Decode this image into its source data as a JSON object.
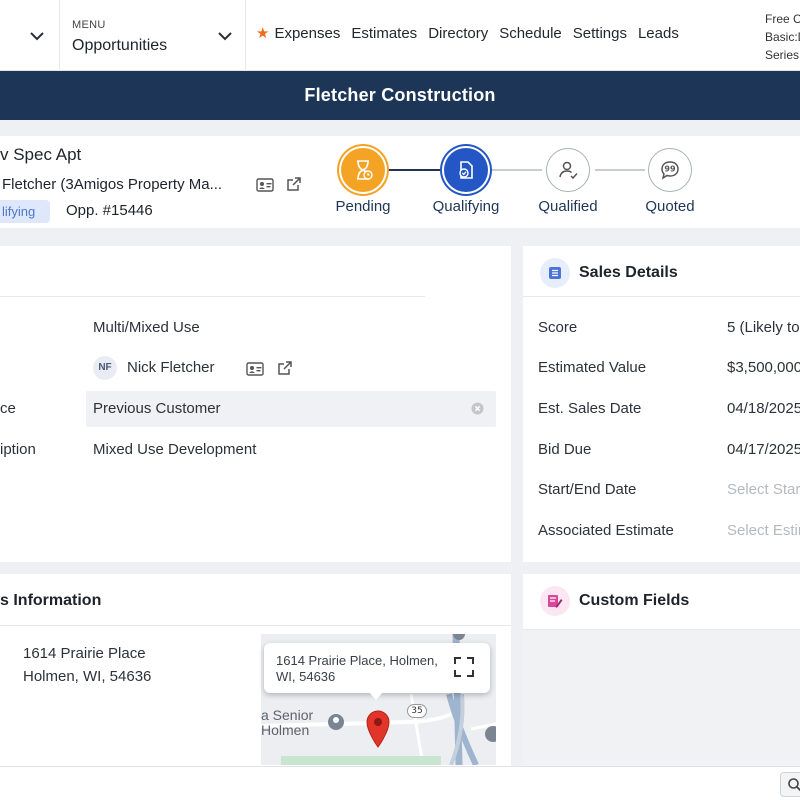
{
  "nav": {
    "menu_label": "MENU",
    "menu_value": "Opportunities",
    "links": [
      "Expenses",
      "Estimates",
      "Directory",
      "Schedule",
      "Settings",
      "Leads"
    ],
    "plan_lines": [
      "Free C",
      "Basic:D",
      "Series:"
    ],
    "accent_star": "#f26b1d"
  },
  "banner": {
    "company": "Fletcher Construction",
    "color": "#1d3557"
  },
  "header": {
    "title": "v Spec Apt",
    "contact": "Fletcher (3Amigos Property Ma...",
    "status_badge": "lifying",
    "opp_number": "Opp. #15446",
    "stages": [
      {
        "label": "Pending",
        "state": "done",
        "icon": "hourglass-icon"
      },
      {
        "label": "Qualifying",
        "state": "current",
        "icon": "document-check-icon"
      },
      {
        "label": "Qualified",
        "state": "upcoming",
        "icon": "user-check-icon"
      },
      {
        "label": "Quoted",
        "state": "upcoming",
        "icon": "quote-bubble-icon"
      }
    ]
  },
  "details": {
    "rows": [
      {
        "label": "",
        "value": "Multi/Mixed Use"
      },
      {
        "label": "",
        "value": "Nick Fletcher",
        "avatar": "NF"
      },
      {
        "label": "ce",
        "value": "Previous Customer"
      },
      {
        "label": "iption",
        "value": "Mixed Use Development"
      }
    ]
  },
  "sales": {
    "title": "Sales Details",
    "rows": [
      {
        "label": "Score",
        "value": "5 (Likely to"
      },
      {
        "label": "Estimated Value",
        "value": "$3,500,000"
      },
      {
        "label": "Est. Sales Date",
        "value": "04/18/2025"
      },
      {
        "label": "Bid Due",
        "value": "04/17/2025"
      },
      {
        "label": "Start/End Date",
        "placeholder": "Select Star"
      },
      {
        "label": "Associated Estimate",
        "placeholder": "Select Estin"
      }
    ]
  },
  "address": {
    "title": "s Information",
    "line1": "1614 Prairie Place",
    "line2": "Holmen, WI, 54636",
    "map_popup": "1614 Prairie Place, Holmen, WI, 54636",
    "map_label1": "a Senior",
    "map_label2": "Holmen",
    "road_shield": "35"
  },
  "custom_fields": {
    "title": "Custom Fields"
  }
}
